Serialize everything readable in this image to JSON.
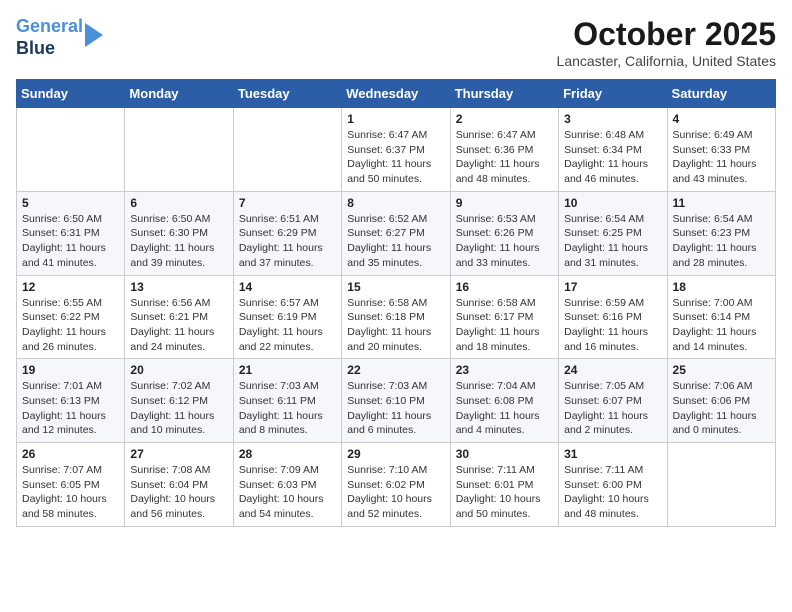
{
  "header": {
    "logo_line1": "General",
    "logo_line2": "Blue",
    "month_title": "October 2025",
    "location": "Lancaster, California, United States"
  },
  "weekdays": [
    "Sunday",
    "Monday",
    "Tuesday",
    "Wednesday",
    "Thursday",
    "Friday",
    "Saturday"
  ],
  "weeks": [
    [
      {
        "day": "",
        "info": ""
      },
      {
        "day": "",
        "info": ""
      },
      {
        "day": "",
        "info": ""
      },
      {
        "day": "1",
        "info": "Sunrise: 6:47 AM\nSunset: 6:37 PM\nDaylight: 11 hours\nand 50 minutes."
      },
      {
        "day": "2",
        "info": "Sunrise: 6:47 AM\nSunset: 6:36 PM\nDaylight: 11 hours\nand 48 minutes."
      },
      {
        "day": "3",
        "info": "Sunrise: 6:48 AM\nSunset: 6:34 PM\nDaylight: 11 hours\nand 46 minutes."
      },
      {
        "day": "4",
        "info": "Sunrise: 6:49 AM\nSunset: 6:33 PM\nDaylight: 11 hours\nand 43 minutes."
      }
    ],
    [
      {
        "day": "5",
        "info": "Sunrise: 6:50 AM\nSunset: 6:31 PM\nDaylight: 11 hours\nand 41 minutes."
      },
      {
        "day": "6",
        "info": "Sunrise: 6:50 AM\nSunset: 6:30 PM\nDaylight: 11 hours\nand 39 minutes."
      },
      {
        "day": "7",
        "info": "Sunrise: 6:51 AM\nSunset: 6:29 PM\nDaylight: 11 hours\nand 37 minutes."
      },
      {
        "day": "8",
        "info": "Sunrise: 6:52 AM\nSunset: 6:27 PM\nDaylight: 11 hours\nand 35 minutes."
      },
      {
        "day": "9",
        "info": "Sunrise: 6:53 AM\nSunset: 6:26 PM\nDaylight: 11 hours\nand 33 minutes."
      },
      {
        "day": "10",
        "info": "Sunrise: 6:54 AM\nSunset: 6:25 PM\nDaylight: 11 hours\nand 31 minutes."
      },
      {
        "day": "11",
        "info": "Sunrise: 6:54 AM\nSunset: 6:23 PM\nDaylight: 11 hours\nand 28 minutes."
      }
    ],
    [
      {
        "day": "12",
        "info": "Sunrise: 6:55 AM\nSunset: 6:22 PM\nDaylight: 11 hours\nand 26 minutes."
      },
      {
        "day": "13",
        "info": "Sunrise: 6:56 AM\nSunset: 6:21 PM\nDaylight: 11 hours\nand 24 minutes."
      },
      {
        "day": "14",
        "info": "Sunrise: 6:57 AM\nSunset: 6:19 PM\nDaylight: 11 hours\nand 22 minutes."
      },
      {
        "day": "15",
        "info": "Sunrise: 6:58 AM\nSunset: 6:18 PM\nDaylight: 11 hours\nand 20 minutes."
      },
      {
        "day": "16",
        "info": "Sunrise: 6:58 AM\nSunset: 6:17 PM\nDaylight: 11 hours\nand 18 minutes."
      },
      {
        "day": "17",
        "info": "Sunrise: 6:59 AM\nSunset: 6:16 PM\nDaylight: 11 hours\nand 16 minutes."
      },
      {
        "day": "18",
        "info": "Sunrise: 7:00 AM\nSunset: 6:14 PM\nDaylight: 11 hours\nand 14 minutes."
      }
    ],
    [
      {
        "day": "19",
        "info": "Sunrise: 7:01 AM\nSunset: 6:13 PM\nDaylight: 11 hours\nand 12 minutes."
      },
      {
        "day": "20",
        "info": "Sunrise: 7:02 AM\nSunset: 6:12 PM\nDaylight: 11 hours\nand 10 minutes."
      },
      {
        "day": "21",
        "info": "Sunrise: 7:03 AM\nSunset: 6:11 PM\nDaylight: 11 hours\nand 8 minutes."
      },
      {
        "day": "22",
        "info": "Sunrise: 7:03 AM\nSunset: 6:10 PM\nDaylight: 11 hours\nand 6 minutes."
      },
      {
        "day": "23",
        "info": "Sunrise: 7:04 AM\nSunset: 6:08 PM\nDaylight: 11 hours\nand 4 minutes."
      },
      {
        "day": "24",
        "info": "Sunrise: 7:05 AM\nSunset: 6:07 PM\nDaylight: 11 hours\nand 2 minutes."
      },
      {
        "day": "25",
        "info": "Sunrise: 7:06 AM\nSunset: 6:06 PM\nDaylight: 11 hours\nand 0 minutes."
      }
    ],
    [
      {
        "day": "26",
        "info": "Sunrise: 7:07 AM\nSunset: 6:05 PM\nDaylight: 10 hours\nand 58 minutes."
      },
      {
        "day": "27",
        "info": "Sunrise: 7:08 AM\nSunset: 6:04 PM\nDaylight: 10 hours\nand 56 minutes."
      },
      {
        "day": "28",
        "info": "Sunrise: 7:09 AM\nSunset: 6:03 PM\nDaylight: 10 hours\nand 54 minutes."
      },
      {
        "day": "29",
        "info": "Sunrise: 7:10 AM\nSunset: 6:02 PM\nDaylight: 10 hours\nand 52 minutes."
      },
      {
        "day": "30",
        "info": "Sunrise: 7:11 AM\nSunset: 6:01 PM\nDaylight: 10 hours\nand 50 minutes."
      },
      {
        "day": "31",
        "info": "Sunrise: 7:11 AM\nSunset: 6:00 PM\nDaylight: 10 hours\nand 48 minutes."
      },
      {
        "day": "",
        "info": ""
      }
    ]
  ]
}
